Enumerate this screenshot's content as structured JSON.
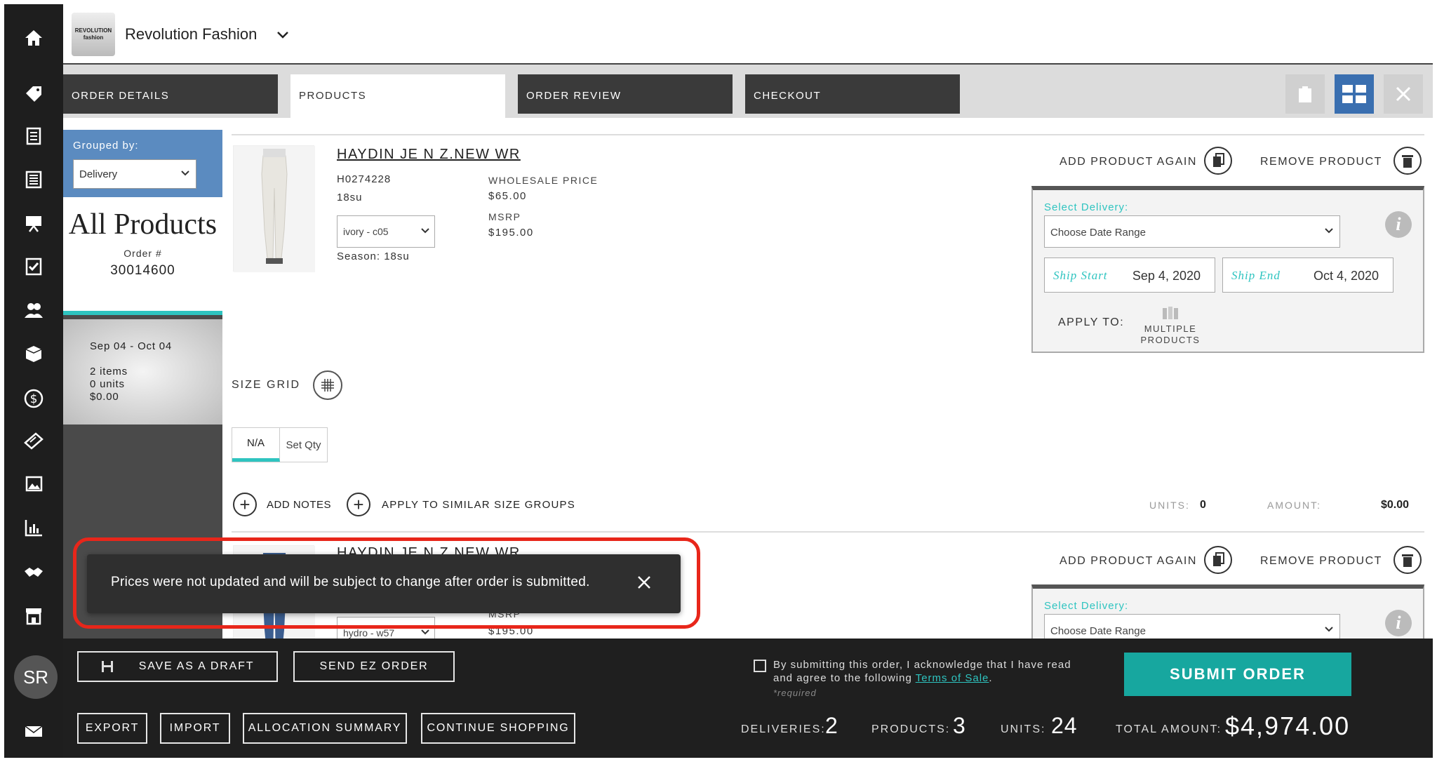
{
  "brand": {
    "logo_text": "REVOLUTION fashion",
    "name": "Revolution Fashion"
  },
  "tabs": [
    {
      "label": "ORDER DETAILS"
    },
    {
      "label": "PRODUCTS"
    },
    {
      "label": "ORDER REVIEW"
    },
    {
      "label": "CHECKOUT"
    }
  ],
  "sidebar": {
    "icons": [
      "home-icon",
      "tag-icon",
      "catalog-icon",
      "lookbook-icon",
      "presentation-icon",
      "checklist-icon",
      "customers-icon",
      "shipping-box-icon",
      "dollar-icon",
      "discount-icon",
      "images-icon",
      "reports-icon",
      "handshake-icon",
      "store-icon"
    ],
    "avatar": "SR"
  },
  "left_panel": {
    "grouped_by_label": "Grouped by:",
    "grouped_by_value": "Delivery",
    "title": "All Products",
    "order_label": "Order #",
    "order_number": "30014600",
    "delivery": {
      "dates": "Sep 04 - Oct 04",
      "items": "2 items",
      "units": "0 units",
      "amount": "$0.00"
    }
  },
  "product1": {
    "name": "HAYDIN JE N Z.NEW WR",
    "sku": "H0274228",
    "season_code": "18su",
    "color": "ivory - c05",
    "season": "Season: 18su",
    "wholesale_label": "WHOLESALE PRICE",
    "wholesale_price": "$65.00",
    "msrp_label": "MSRP",
    "msrp": "$195.00",
    "add_again": "ADD PRODUCT AGAIN",
    "remove": "REMOVE PRODUCT",
    "select_delivery_label": "Select Delivery:",
    "date_range_placeholder": "Choose Date Range",
    "ship_start_label": "Ship Start",
    "ship_start": "Sep 4, 2020",
    "ship_end_label": "Ship End",
    "ship_end": "Oct 4, 2020",
    "apply_to_label": "APPLY TO:",
    "multiple_products_label": "MULTIPLE PRODUCTS",
    "size_grid_label": "SIZE GRID",
    "size_na": "N/A",
    "set_qty": "Set Qty",
    "add_notes": "ADD NOTES",
    "apply_similar": "APPLY TO SIMILAR SIZE GROUPS",
    "units_label": "UNITS:",
    "units": "0",
    "amount_label": "AMOUNT:",
    "amount": "$0.00"
  },
  "product2": {
    "name": "HAYDIN JE N Z.NEW WR",
    "color": "hydro - w57",
    "msrp_label": "MSRP",
    "msrp": "$195.00",
    "add_again": "ADD PRODUCT AGAIN",
    "remove": "REMOVE PRODUCT",
    "select_delivery_label": "Select Delivery:",
    "date_range_placeholder": "Choose Date Range"
  },
  "toast": {
    "message": "Prices were not updated and will be subject to change after order is submitted."
  },
  "footer": {
    "save_draft": "SAVE AS A DRAFT",
    "send_ez": "SEND EZ ORDER",
    "export": "EXPORT",
    "import": "IMPORT",
    "allocation": "ALLOCATION SUMMARY",
    "continue": "CONTINUE SHOPPING",
    "ack_text": "By submitting this order, I acknowledge that I have read and agree to the following ",
    "terms_link": "Terms of Sale",
    "required": "*required",
    "submit": "SUBMIT ORDER",
    "deliveries_label": "DELIVERIES:",
    "deliveries": "2",
    "products_label": "PRODUCTS:",
    "products": "3",
    "units_label": "UNITS:",
    "units": "24",
    "total_label": "TOTAL AMOUNT:",
    "total": "$4,974.00"
  },
  "colors": {
    "accent": "#2ec4c0",
    "submit": "#17a79f",
    "group_bg": "#5b8bc0",
    "highlight": "#e8261a"
  }
}
